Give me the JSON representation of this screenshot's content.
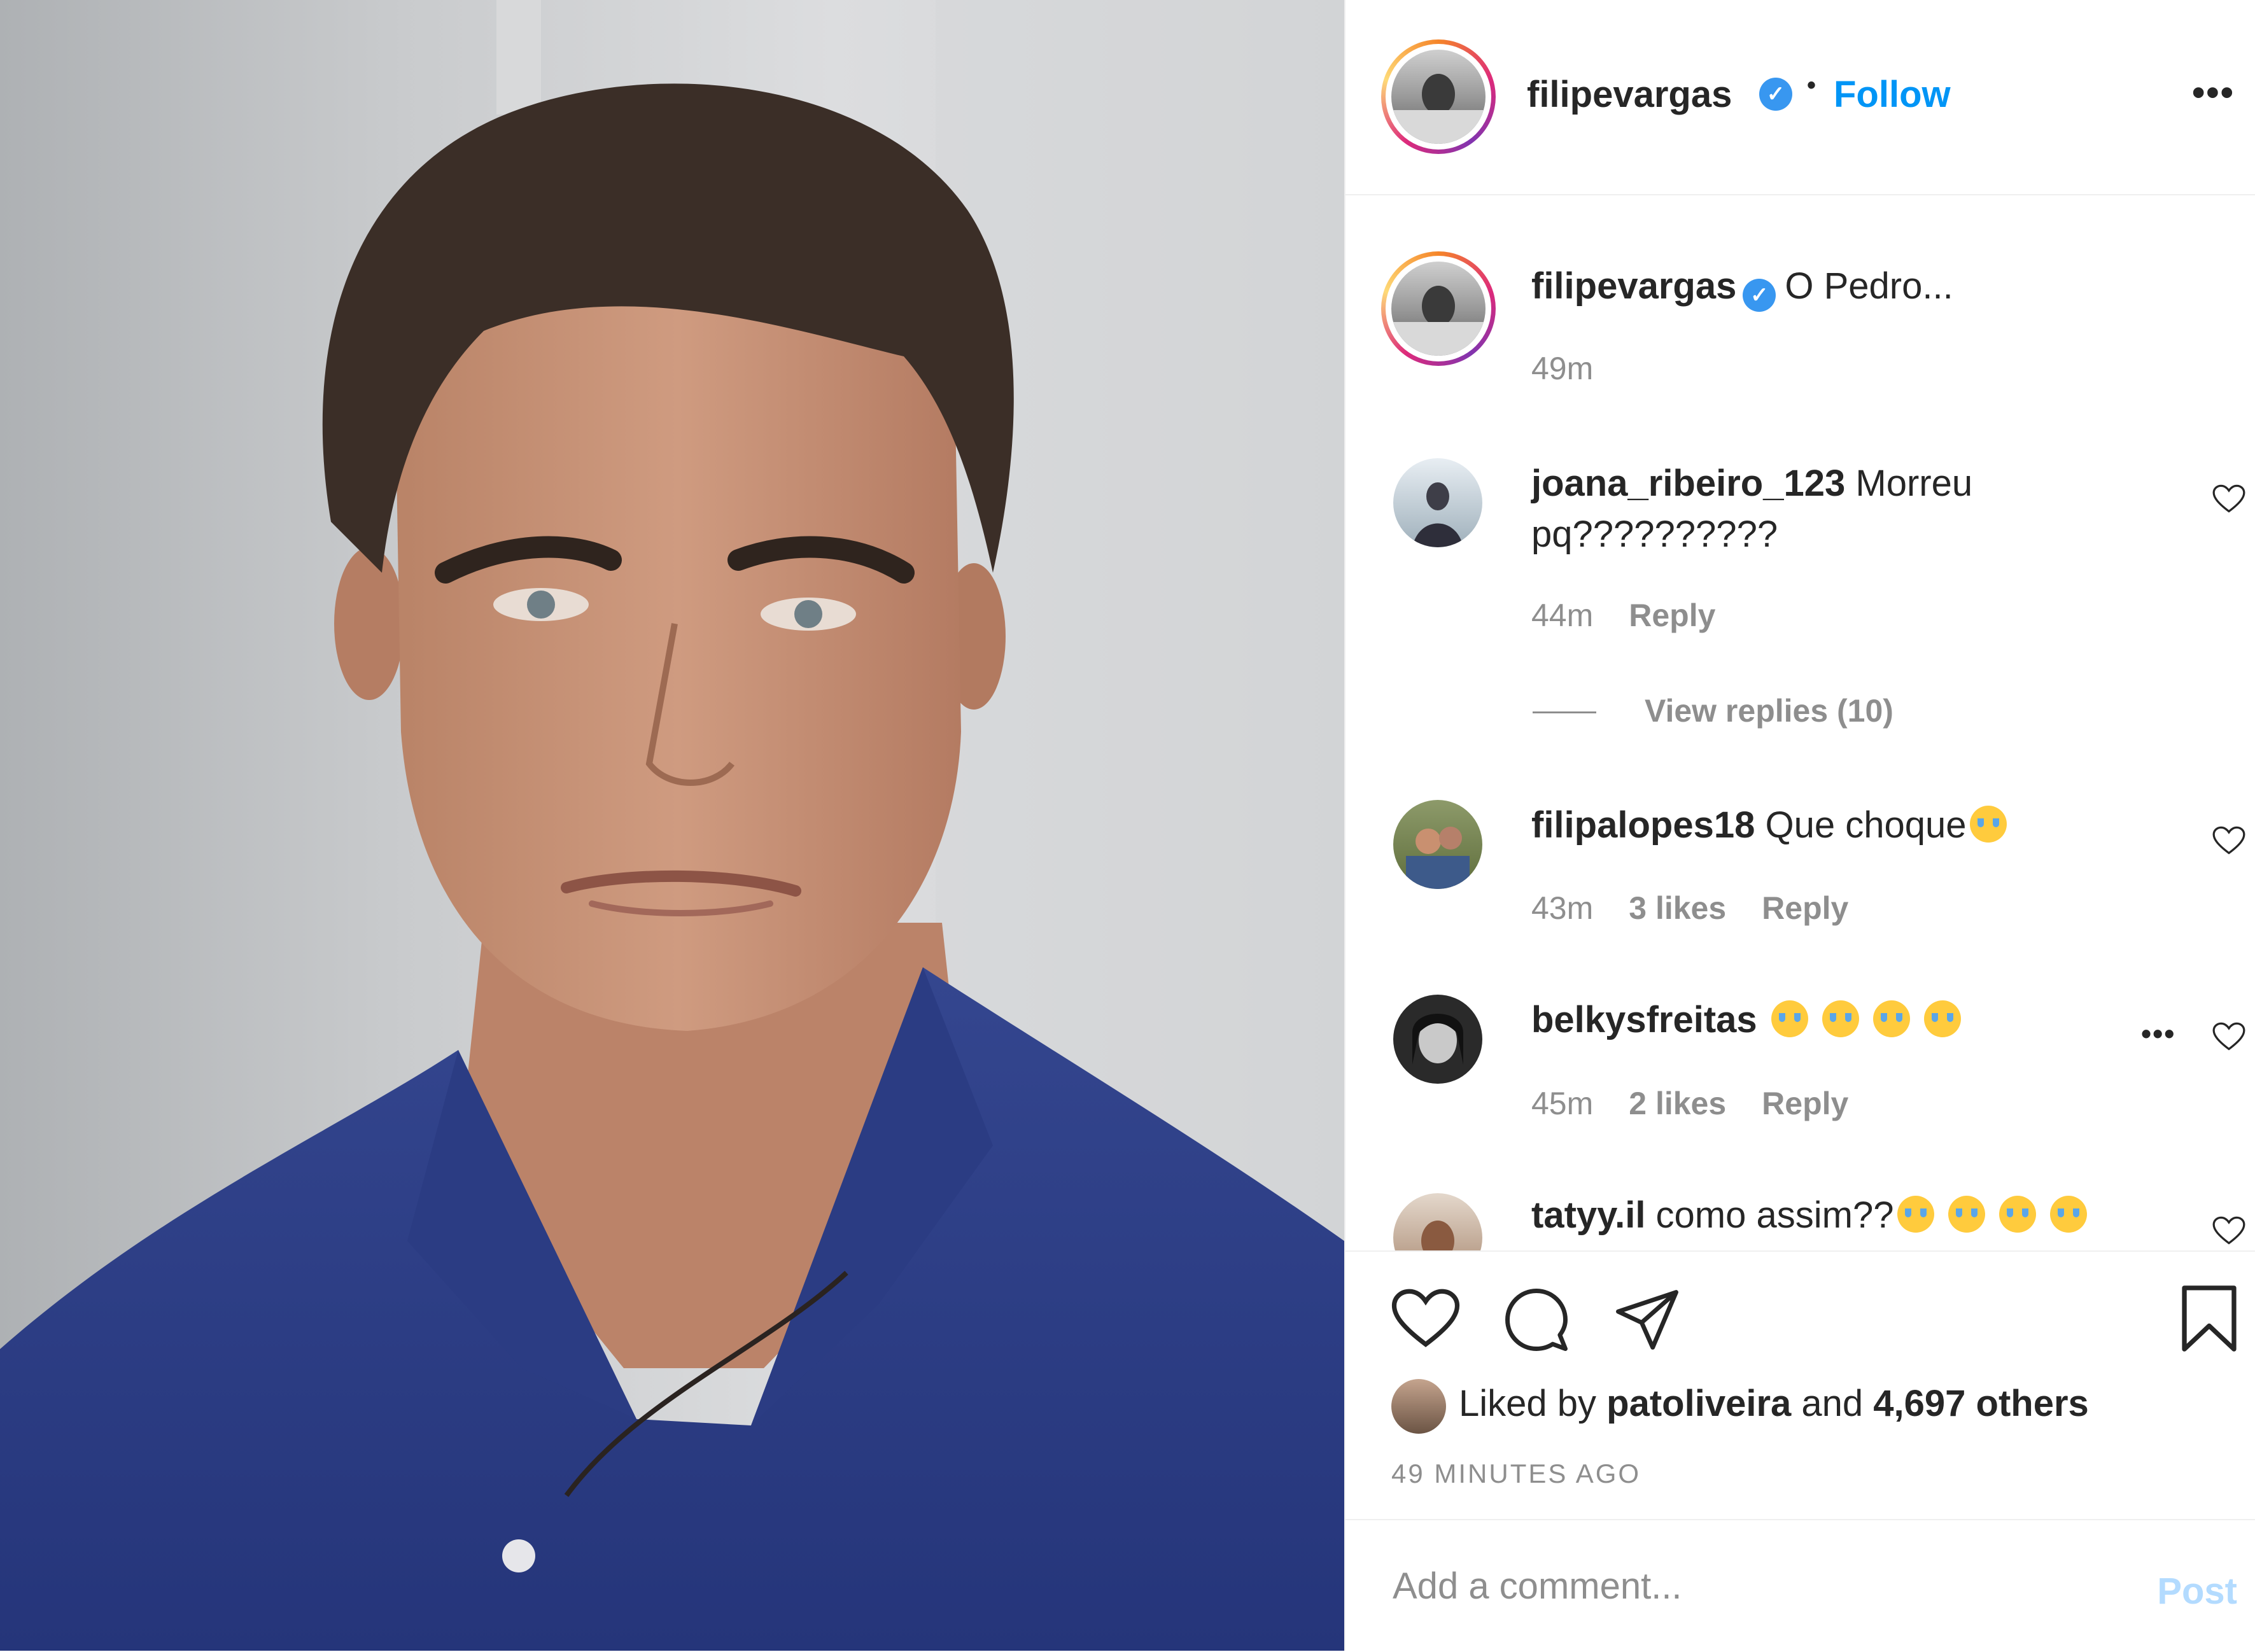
{
  "post": {
    "username": "filipevargas",
    "follow_label": "Follow",
    "dot": "•",
    "more_label": "•••",
    "caption_username": "filipevargas",
    "caption_text": "O Pedro...",
    "caption_time": "49m"
  },
  "comments": [
    {
      "username": "joana_ribeiro_123",
      "text_line1": " Morreu",
      "text_line2": "pq??????????",
      "time": "44m",
      "reply_label": "Reply",
      "view_replies": "View replies (10)"
    },
    {
      "username": "filipalopes18",
      "text": " Que choque",
      "time": "43m",
      "likes": "3 likes",
      "reply_label": "Reply"
    },
    {
      "username": "belkysfreitas",
      "text": "",
      "time": "45m",
      "likes": "2 likes",
      "reply_label": "Reply",
      "more_label": "•••"
    },
    {
      "username": "tatyy.il",
      "text": " como assim??"
    }
  ],
  "footer": {
    "liked_prefix": "Liked by ",
    "liked_user": "patoliveira",
    "liked_mid": " and ",
    "liked_count": "4,697 others",
    "time_ago": "49 MINUTES AGO",
    "comment_placeholder": "Add a comment...",
    "post_label": "Post"
  },
  "colors": {
    "follow_blue": "#0095f6",
    "verified_blue": "#3897f0",
    "muted_grey": "#8e8e8e",
    "post_disabled": "#b3dbff",
    "shirt_blue": "#2e3f86"
  },
  "icons": [
    "verified-badge-icon",
    "more-options-icon",
    "heart-icon",
    "comment-icon",
    "share-icon",
    "bookmark-icon"
  ]
}
